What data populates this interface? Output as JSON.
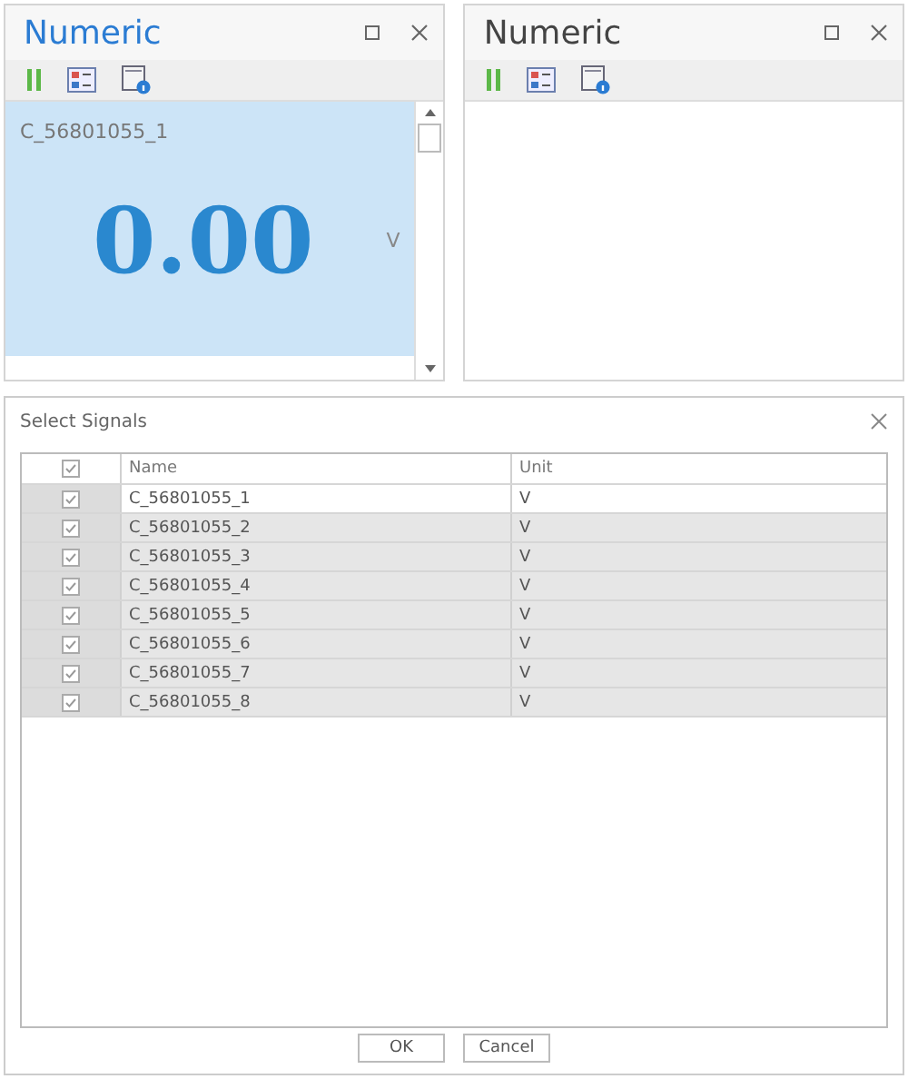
{
  "panels": [
    {
      "title": "Numeric",
      "active": true,
      "signals": [
        {
          "name": "C_56801055_1",
          "value": "0.00",
          "unit": "V",
          "selected": true
        }
      ]
    },
    {
      "title": "Numeric",
      "active": false
    }
  ],
  "dialog": {
    "title": "Select Signals",
    "columns": [
      "Name",
      "Unit"
    ],
    "header_checked": true,
    "rows": [
      {
        "checked": true,
        "name": "C_56801055_1",
        "unit": "V",
        "selected": true
      },
      {
        "checked": true,
        "name": "C_56801055_2",
        "unit": "V",
        "selected": false
      },
      {
        "checked": true,
        "name": "C_56801055_3",
        "unit": "V",
        "selected": false
      },
      {
        "checked": true,
        "name": "C_56801055_4",
        "unit": "V",
        "selected": false
      },
      {
        "checked": true,
        "name": "C_56801055_5",
        "unit": "V",
        "selected": false
      },
      {
        "checked": true,
        "name": "C_56801055_6",
        "unit": "V",
        "selected": false
      },
      {
        "checked": true,
        "name": "C_56801055_7",
        "unit": "V",
        "selected": false
      },
      {
        "checked": true,
        "name": "C_56801055_8",
        "unit": "V",
        "selected": false
      }
    ],
    "buttons": [
      "OK",
      "Cancel"
    ]
  }
}
